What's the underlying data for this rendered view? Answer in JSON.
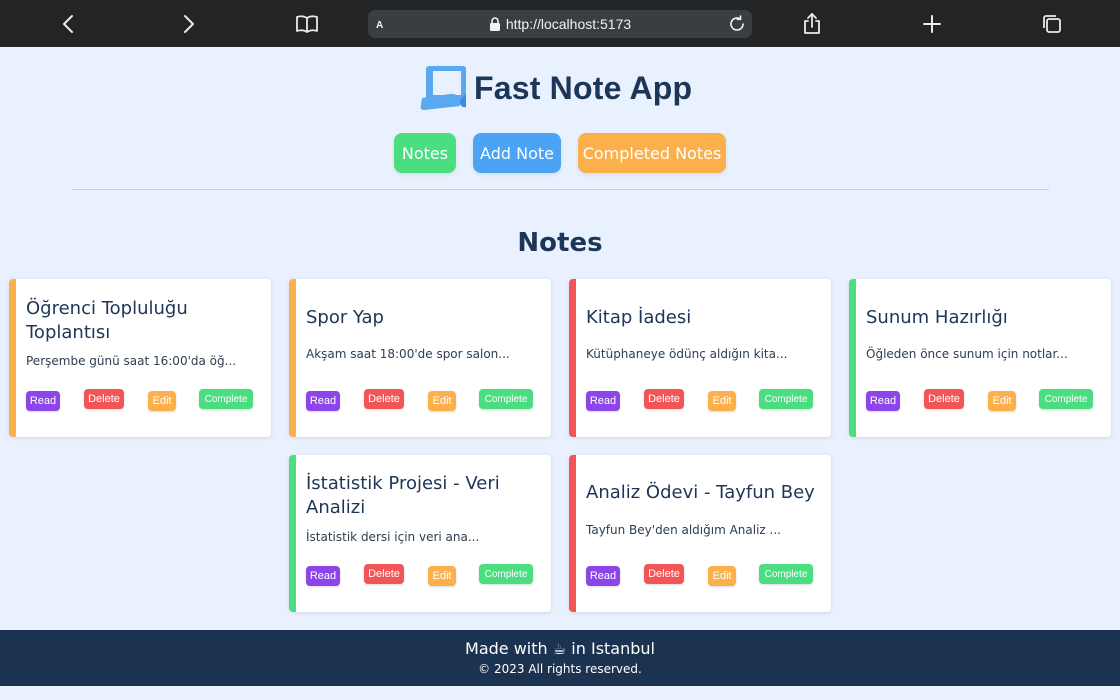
{
  "browser": {
    "url": "http://localhost:5173",
    "reader_label": "A",
    "icons": [
      "back-icon",
      "forward-icon",
      "book-icon",
      "lock-icon",
      "reload-icon",
      "share-icon",
      "plus-icon",
      "tabs-icon"
    ]
  },
  "header": {
    "app_title": "Fast Note App",
    "nav": {
      "notes": "Notes",
      "add_note": "Add Note",
      "completed_notes": "Completed Notes"
    }
  },
  "main": {
    "section_title": "Notes",
    "actions": {
      "read": "Read",
      "delete": "Delete",
      "edit": "Edit",
      "complete": "Complete"
    },
    "notes": [
      {
        "title": "Öğrenci Topluluğu Toplantısı",
        "description": "Perşembe günü saat 16:00'da öğ...",
        "accent": "#fbb04c"
      },
      {
        "title": "Spor Yap",
        "description": "Akşam saat 18:00'de spor salon...",
        "accent": "#fbb04c"
      },
      {
        "title": "Kitap İadesi",
        "description": "Kütüphaneye ödünç aldığın kita...",
        "accent": "#f25555"
      },
      {
        "title": "Sunum Hazırlığı",
        "description": "Öğleden önce sunum için notlar...",
        "accent": "#4ade80"
      },
      {
        "title": "İstatistik Projesi - Veri Analizi",
        "description": "İstatistik dersi için veri ana...",
        "accent": "#4ade80"
      },
      {
        "title": "Analiz Ödevi - Tayfun Bey",
        "description": "Tayfun Bey'den aldığım Analiz ...",
        "accent": "#f25555"
      }
    ]
  },
  "footer": {
    "made_with_prefix": "Made with",
    "made_with_icon": "☕",
    "made_with_suffix": "in Istanbul",
    "copyright": "© 2023 All rights reserved."
  },
  "colors": {
    "background": "#e8f1fd",
    "brand_dark": "#1d3557",
    "green": "#4ade80",
    "blue": "#4aa3f5",
    "orange": "#fbb04c",
    "red": "#f25555",
    "purple": "#8b45e9",
    "footer": "#1b3350"
  }
}
